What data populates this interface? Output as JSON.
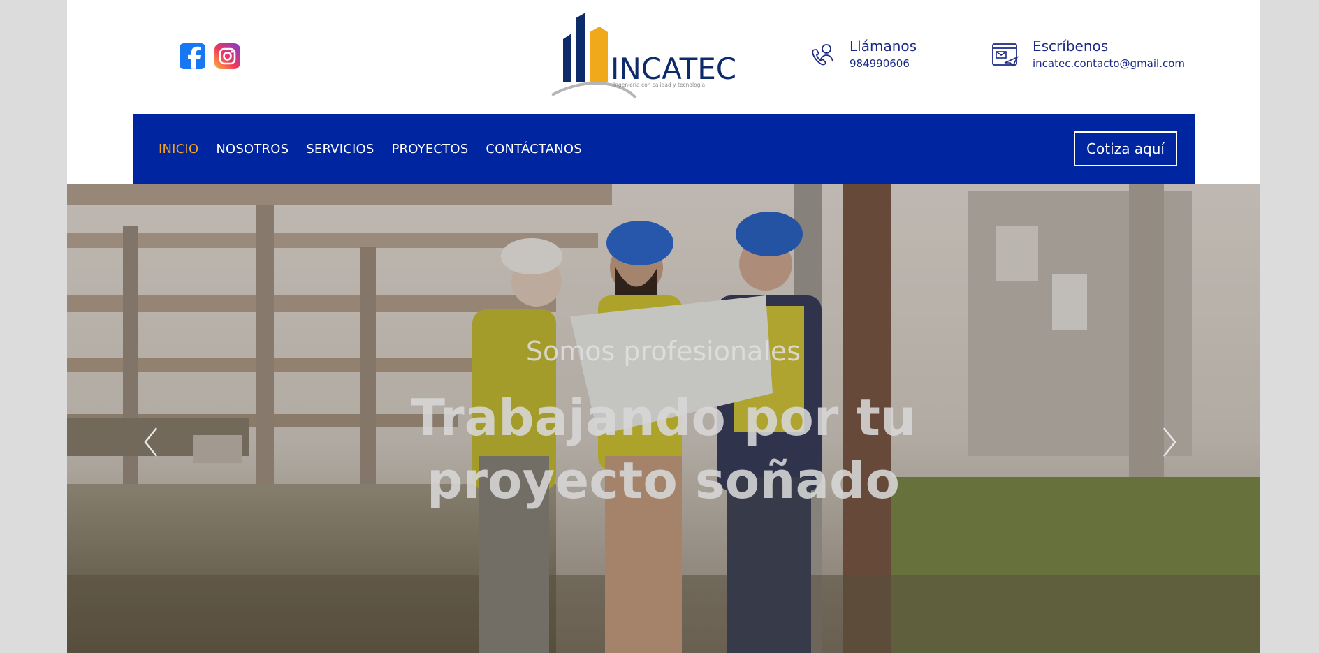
{
  "social": {
    "facebook": "facebook-icon",
    "instagram": "instagram-icon"
  },
  "logo": {
    "name": "INCATEC",
    "tagline": "Ingeniería con calidad y tecnología"
  },
  "contact": {
    "phone": {
      "title": "Llámanos",
      "value": "984990606"
    },
    "email": {
      "title": "Escríbenos",
      "value": "incatec.contacto@gmail.com"
    }
  },
  "nav": {
    "items": [
      {
        "label": "INICIO",
        "active": true
      },
      {
        "label": "NOSOTROS"
      },
      {
        "label": "SERVICIOS"
      },
      {
        "label": "PROYECTOS"
      },
      {
        "label": "CONTÁCTANOS"
      }
    ],
    "cta": "Cotiza aquí"
  },
  "hero": {
    "subtitle": "Somos profesionales",
    "headline": "Trabajando por tu proyecto soñado"
  },
  "colors": {
    "brand_blue": "#0025a0",
    "accent_orange": "#f5a31a",
    "text_blue": "#1b2a86"
  }
}
